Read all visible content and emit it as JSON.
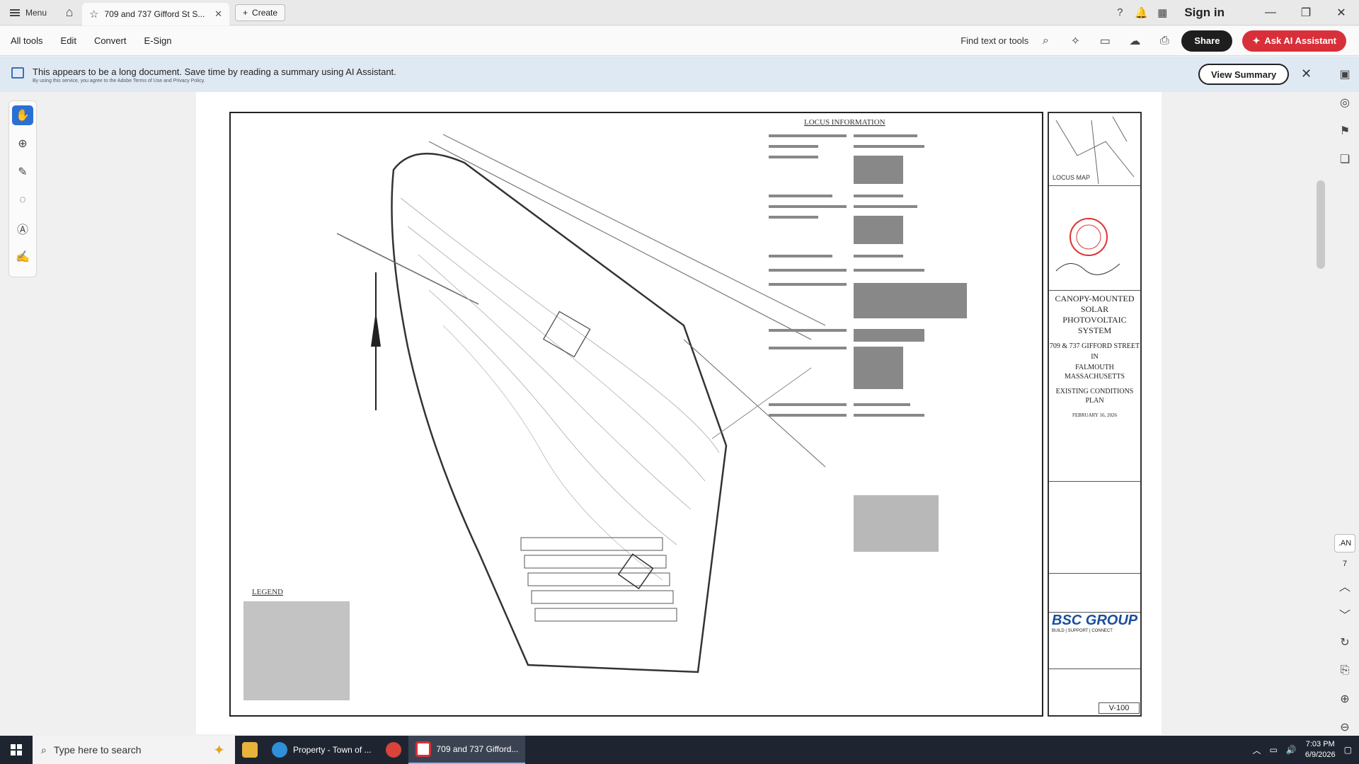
{
  "titlebar": {
    "menu_label": "Menu",
    "tab_title": "709 and 737 Gifford St S...",
    "create_label": "Create",
    "signin_label": "Sign in"
  },
  "toolbar": {
    "items": [
      "All tools",
      "Edit",
      "Convert",
      "E-Sign"
    ],
    "find_label": "Find text or tools",
    "share_label": "Share",
    "ai_label": "Ask AI Assistant"
  },
  "banner": {
    "text": "This appears to be a long document. Save time by reading a summary using AI Assistant.",
    "subtext": "By using this service, you agree to the Adobe Terms of Use and Privacy Policy.",
    "button_label": "View Summary"
  },
  "drawing": {
    "locus_info_title": "LOCUS INFORMATION",
    "legend_title": "LEGEND",
    "locus_map_label": "LOCUS MAP",
    "project_title": "CANOPY-MOUNTED SOLAR PHOTOVOLTAIC SYSTEM",
    "address_line1": "709 & 737 GIFFORD STREET",
    "address_in": "IN",
    "address_line2": "FALMOUTH MASSACHUSETTS",
    "plan_title": "EXISTING CONDITIONS PLAN",
    "plan_date": "FEBRUARY 16, 2026",
    "firm": "BSC GROUP",
    "firm_tagline": "BUILD | SUPPORT | CONNECT",
    "sheet_number": "V-100"
  },
  "pagenav": {
    "page_box": ".AN",
    "page_number": "7"
  },
  "taskbar": {
    "search_placeholder": "Type here to search",
    "app1_label": "Property - Town of ...",
    "app2_label": "709 and 737 Gifford...",
    "time": "7:03 PM",
    "date": "6/9/2026"
  },
  "colors": {
    "accent_blue": "#2a6fd6",
    "ai_red": "#d8303a",
    "banner_bg": "#dfe9f4",
    "taskbar_bg": "#1f2530"
  }
}
